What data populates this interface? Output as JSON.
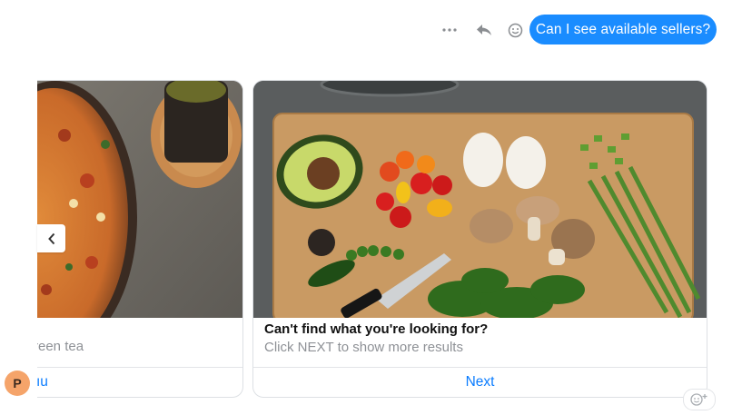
{
  "toolbar": {
    "more_icon": "more-dots-icon",
    "reply_icon": "reply-arrow-icon",
    "react_icon": "smiley-icon"
  },
  "message": {
    "text": "Can I see available sellers?",
    "bubble_color": "#1a8cff"
  },
  "carousel": {
    "left_card": {
      "subtitle_fragment": "reen tea",
      "button_fragment": "ıu"
    },
    "right_card": {
      "title": "Can't find what you're looking for?",
      "subtitle": "Click NEXT to show more results",
      "button_label": "Next"
    },
    "prev_icon": "chevron-left-icon",
    "accent_color": "#0a7cff"
  },
  "avatar": {
    "initial": "P"
  },
  "reaction": {
    "icon": "add-reaction-icon"
  }
}
